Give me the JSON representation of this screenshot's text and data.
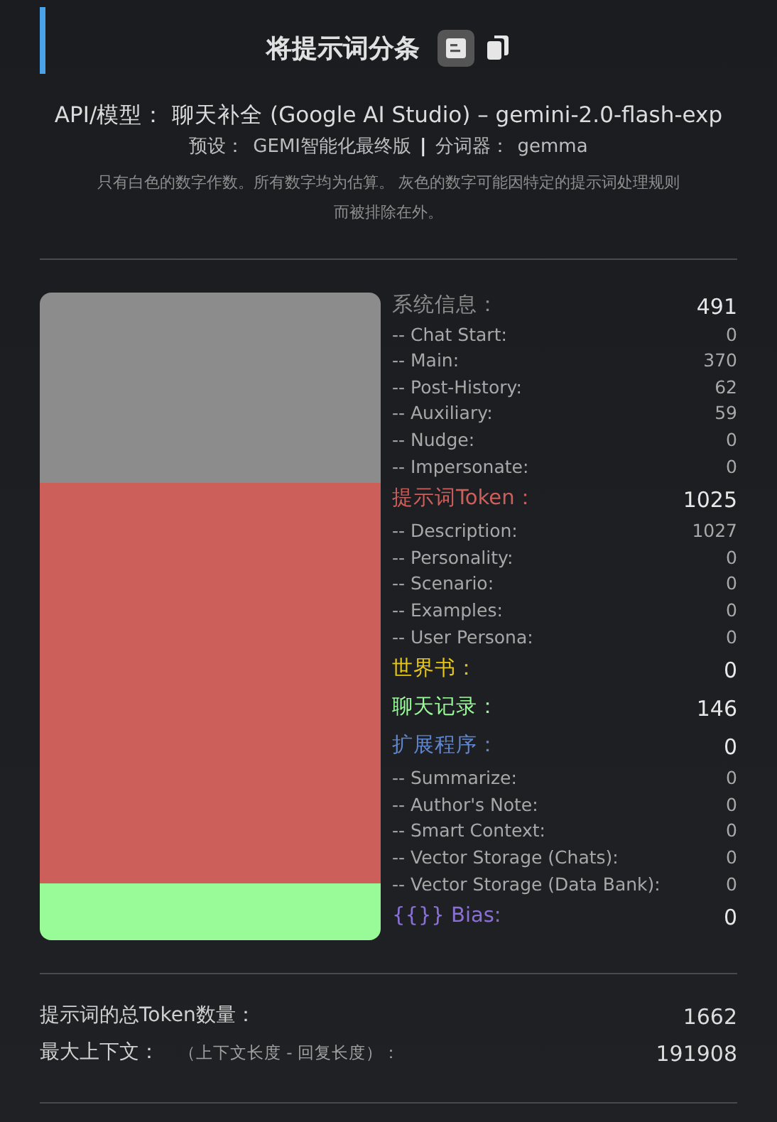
{
  "header": {
    "title": "将提示词分条"
  },
  "model_line": {
    "label": "API/模型：",
    "value": "聊天补全 (Google AI Studio) – gemini-2.0-flash-exp"
  },
  "preset_line": {
    "preset_label": "预设：",
    "preset_value": "GEMI智能化最终版",
    "separator": "|",
    "tokenizer_label": "分词器：",
    "tokenizer_value": "gemma"
  },
  "note": "只有白色的数字作数。所有数字均为估算。 灰色的数字可能因特定的提示词处理规则而被排除在外。",
  "sections": [
    {
      "title": "系统信息：",
      "total": "491",
      "color": "#8c8c8c",
      "items": [
        {
          "label": "-- Chat Start:",
          "value": "0"
        },
        {
          "label": "-- Main:",
          "value": "370"
        },
        {
          "label": "-- Post-History:",
          "value": "62"
        },
        {
          "label": "-- Auxiliary:",
          "value": "59"
        },
        {
          "label": "-- Nudge:",
          "value": "0"
        },
        {
          "label": "-- Impersonate:",
          "value": "0"
        }
      ]
    },
    {
      "title": "提示词Token：",
      "total": "1025",
      "color": "#cd5f5b",
      "items": [
        {
          "label": "-- Description:",
          "value": "1027"
        },
        {
          "label": "-- Personality:",
          "value": "0"
        },
        {
          "label": "-- Scenario:",
          "value": "0"
        },
        {
          "label": "-- Examples:",
          "value": "0"
        },
        {
          "label": "-- User Persona:",
          "value": "0"
        }
      ]
    },
    {
      "title": "世界书：",
      "total": "0",
      "color": "#e6c619"
    },
    {
      "title": "聊天记录：",
      "total": "146",
      "color": "#98fb98"
    },
    {
      "title": "扩展程序：",
      "total": "0",
      "color": "#5f86d0",
      "items": [
        {
          "label": "-- Summarize:",
          "value": "0"
        },
        {
          "label": "-- Author's Note:",
          "value": "0"
        },
        {
          "label": "-- Smart Context:",
          "value": "0"
        },
        {
          "label": "-- Vector Storage (Chats):",
          "value": "0"
        },
        {
          "label": "-- Vector Storage (Data Bank):",
          "value": "0"
        }
      ]
    },
    {
      "title": "{{}} Bias:",
      "total": "0",
      "color": "#8a70d6"
    }
  ],
  "totals": [
    {
      "label": "提示词的总Token数量：",
      "value": "1662"
    },
    {
      "label": "最大上下文：",
      "hint": "（上下文长度 - 回复长度）：",
      "value": "191908"
    }
  ]
}
